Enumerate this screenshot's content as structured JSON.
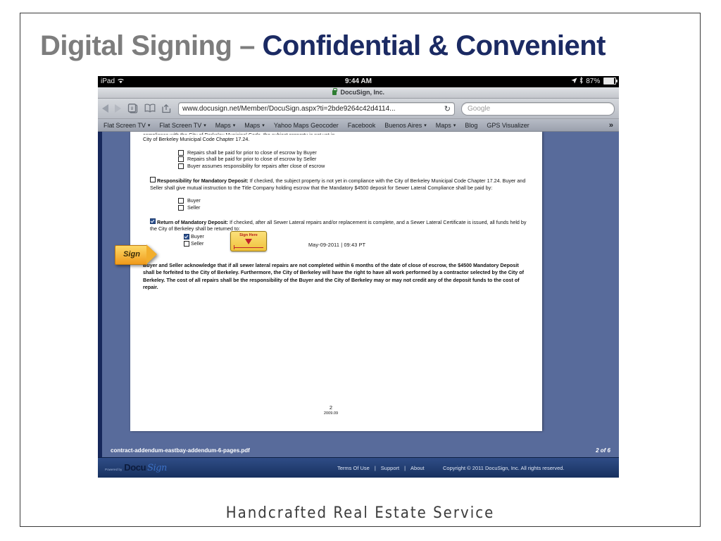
{
  "slide": {
    "title": {
      "part1": "Digital Signing",
      "dash": "–",
      "part2": "Confidential & Convenient"
    },
    "tagline": "Handcrafted  Real  Estate  Service"
  },
  "ipad": {
    "statusbar": {
      "device": "iPad",
      "wifi_icon": "wifi-icon",
      "time": "9:44 AM",
      "location_icon": "location-arrow-icon",
      "bluetooth_icon": "bluetooth-icon",
      "battery": "87%"
    },
    "titlebar": {
      "lock_icon": "lock-icon",
      "page_title": "DocuSign, Inc."
    },
    "toolbar": {
      "back_icon": "back-arrow-icon",
      "forward_icon": "forward-arrow-icon",
      "tabs_icon": "tabs-icon",
      "tabs_count": "8",
      "bookmarks_icon": "book-icon",
      "share_icon": "share-icon",
      "url": "www.docusign.net/Member/DocuSign.aspx?ti=2bde9264c42d4114...",
      "reload_icon": "reload-icon",
      "search_placeholder": "Google"
    },
    "bookmarks": [
      {
        "label": "Flat Screen TV",
        "caret": "▾"
      },
      {
        "label": "Flat Screen TV",
        "caret": "▾"
      },
      {
        "label": "Maps",
        "caret": "▾"
      },
      {
        "label": "Maps",
        "caret": "▾"
      },
      {
        "label": "Yahoo Maps Geocoder",
        "caret": ""
      },
      {
        "label": "Facebook",
        "caret": ""
      },
      {
        "label": "Buenos Aires",
        "caret": "▾"
      },
      {
        "label": "Maps",
        "caret": "▾"
      },
      {
        "label": "Blog",
        "caret": ""
      },
      {
        "label": "GPS Visualizer",
        "caret": ""
      }
    ],
    "bookmarks_more": "»"
  },
  "document": {
    "clipped_top_line": "compliance with the City of Berkeley Municipal Code, the subject property is not yet in",
    "line_city": "City of Berkeley Municipal Code Chapter 17.24.",
    "repair_options": [
      "Repairs shall be paid for prior to close of escrow by Buyer",
      "Repairs shall be paid for prior to close of escrow by Seller",
      "Buyer assumes responsibility for repairs after close of escrow"
    ],
    "responsibility": {
      "heading": "Responsibility for Mandatory Deposit:",
      "body": " If checked, the subject property is not yet in compliance with the City of Berkeley Municipal Code Chapter 17.24.  Buyer and Seller shall give mutual instruction to the Title Company holding escrow that the Mandatory $4500 deposit for Sewer Lateral Compliance shall be paid by:",
      "options": [
        "Buyer",
        "Seller"
      ]
    },
    "return": {
      "heading": "Return of Mandatory Deposit:",
      "body": "  If checked, after all Sewer Lateral repairs and/or replacement is complete, and a Sewer Lateral Certificate is issued, all funds held by the City of Berkeley shall be returned to:",
      "option_buyer": "Buyer",
      "option_seller": "Seller",
      "sign_here_label": "Sign Here",
      "signed_timestamp": "May-09-2011 | 09:43 PT"
    },
    "acknowledgement": "Buyer and Seller acknowledge that if all sewer lateral repairs are not completed within 6 months of the date of close of escrow, the $4500 Mandatory Deposit shall be forfeited to the City of Berkeley.  Furthermore, the City of Berkeley will have the right to have all work performed by a contractor selected by the City of Berkeley.  The cost of all repairs shall be the responsibility of the Buyer and the City of Berkeley may or may not credit any of the deposit funds to the cost of repair.",
    "page_number": "2",
    "page_revision": "2009.09",
    "footer_filename": "contract-addendum-eastbay-addendum-6-pages.pdf",
    "footer_pagecount": "2 of 6"
  },
  "sign_flag": {
    "label": "Sign"
  },
  "docusign_bar": {
    "powered_by": "Powered by",
    "logo_docu": "Docu",
    "logo_sign": "Sign",
    "links": [
      "Terms Of Use",
      "Support",
      "About"
    ],
    "separator": "|",
    "copyright": "Copyright © 2011 DocuSign, Inc. All rights reserved."
  },
  "colors": {
    "title_grey": "#7d7d7d",
    "title_navy": "#1b2a63",
    "viewer_blue": "#586b9b",
    "viewer_edge": "#16275a",
    "docusign_blue": "#2f4c86",
    "sign_gold": "#f0a81f",
    "sign_here_red": "#c1232b"
  }
}
